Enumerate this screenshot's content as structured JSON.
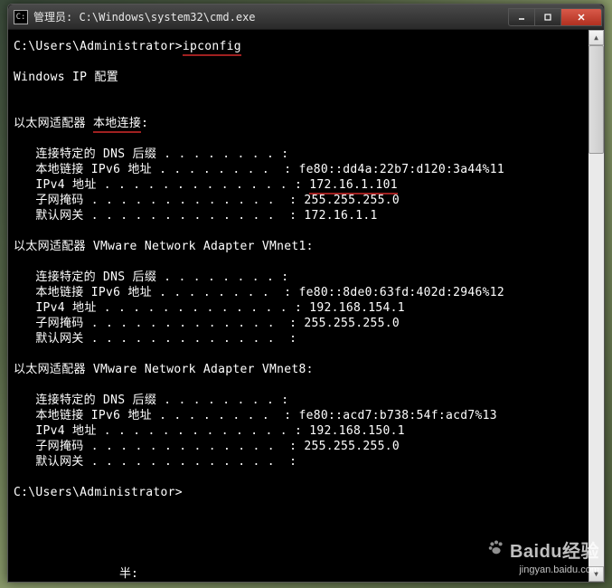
{
  "window": {
    "title": "管理员: C:\\Windows\\system32\\cmd.exe"
  },
  "prompt": {
    "path": "C:\\Users\\Administrator>",
    "command": "ipconfig"
  },
  "header": "Windows IP 配置",
  "adapters": [
    {
      "title_prefix": "以太网适配器 ",
      "title_name": "本地连接",
      "title_suffix": ":",
      "underline_name": true,
      "rows": [
        {
          "label": "连接特定的 DNS 后缀",
          "value": "",
          "underline": false
        },
        {
          "label": "本地链接 IPv6 地址",
          "value": "fe80::dd4a:22b7:d120:3a44%11",
          "underline": false
        },
        {
          "label": "IPv4 地址",
          "value": "172.16.1.101",
          "underline": true
        },
        {
          "label": "子网掩码",
          "value": "255.255.255.0",
          "underline": false
        },
        {
          "label": "默认网关",
          "value": "172.16.1.1",
          "underline": false
        }
      ]
    },
    {
      "title_prefix": "以太网适配器 ",
      "title_name": "VMware Network Adapter VMnet1",
      "title_suffix": ":",
      "underline_name": false,
      "rows": [
        {
          "label": "连接特定的 DNS 后缀",
          "value": "",
          "underline": false
        },
        {
          "label": "本地链接 IPv6 地址",
          "value": "fe80::8de0:63fd:402d:2946%12",
          "underline": false
        },
        {
          "label": "IPv4 地址",
          "value": "192.168.154.1",
          "underline": false
        },
        {
          "label": "子网掩码",
          "value": "255.255.255.0",
          "underline": false
        },
        {
          "label": "默认网关",
          "value": "",
          "underline": false
        }
      ]
    },
    {
      "title_prefix": "以太网适配器 ",
      "title_name": "VMware Network Adapter VMnet8",
      "title_suffix": ":",
      "underline_name": false,
      "rows": [
        {
          "label": "连接特定的 DNS 后缀",
          "value": "",
          "underline": false
        },
        {
          "label": "本地链接 IPv6 地址",
          "value": "fe80::acd7:b738:54f:acd7%13",
          "underline": false
        },
        {
          "label": "IPv4 地址",
          "value": "192.168.150.1",
          "underline": false
        },
        {
          "label": "子网掩码",
          "value": "255.255.255.0",
          "underline": false
        },
        {
          "label": "默认网关",
          "value": "",
          "underline": false
        }
      ]
    }
  ],
  "end_prompt": "C:\\Users\\Administrator>",
  "bottom_fragment": "半:",
  "watermark": {
    "brand": "Bai",
    "brand2": "du",
    "brand3": "经验",
    "url": "jingyan.baidu.com"
  }
}
